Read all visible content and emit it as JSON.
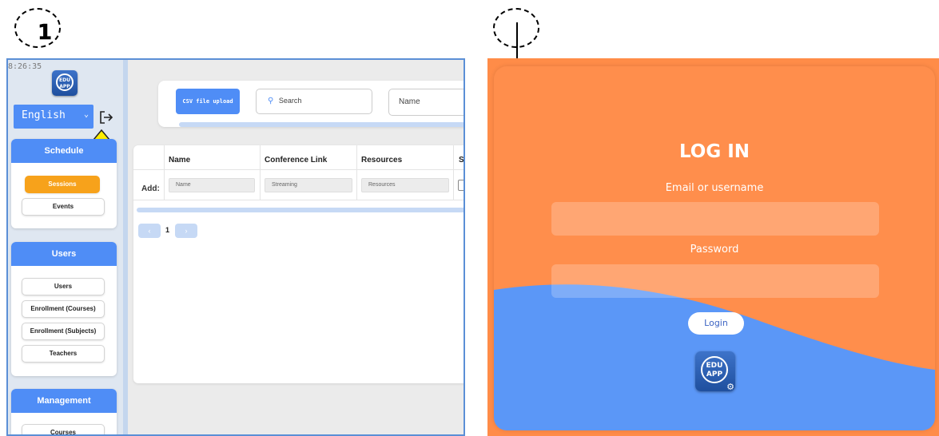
{
  "markers": {
    "left_step": "1"
  },
  "left_screen": {
    "clock": "8:26:35",
    "logo_text_top": "EDU",
    "logo_text_bottom": "APP",
    "language": "English",
    "sidebar": {
      "schedule": {
        "title": "Schedule",
        "items": [
          "Sessions",
          "Events"
        ]
      },
      "users": {
        "title": "Users",
        "items": [
          "Users",
          "Enrollment (Courses)",
          "Enrollment (Subjects)",
          "Teachers"
        ]
      },
      "management": {
        "title": "Management",
        "items": [
          "Courses"
        ]
      }
    },
    "toolbar": {
      "csv_label": "CSV file upload",
      "search_placeholder": "Search",
      "sort_value": "Name"
    },
    "table": {
      "headers": [
        "Name",
        "Conference Link",
        "Resources",
        "S"
      ],
      "add_label": "Add:",
      "add_placeholders": [
        "Name",
        "Streaming",
        "Resources"
      ]
    },
    "pagination": {
      "prev": "‹",
      "current": "1",
      "next": "›"
    }
  },
  "right_screen": {
    "title": "LOG IN",
    "email_label": "Email or username",
    "password_label": "Password",
    "login_button": "Login",
    "logo_text_top": "EDU",
    "logo_text_bottom": "APP",
    "colors": {
      "orange": "#ff8e4c",
      "blue": "#5b97f7"
    }
  }
}
